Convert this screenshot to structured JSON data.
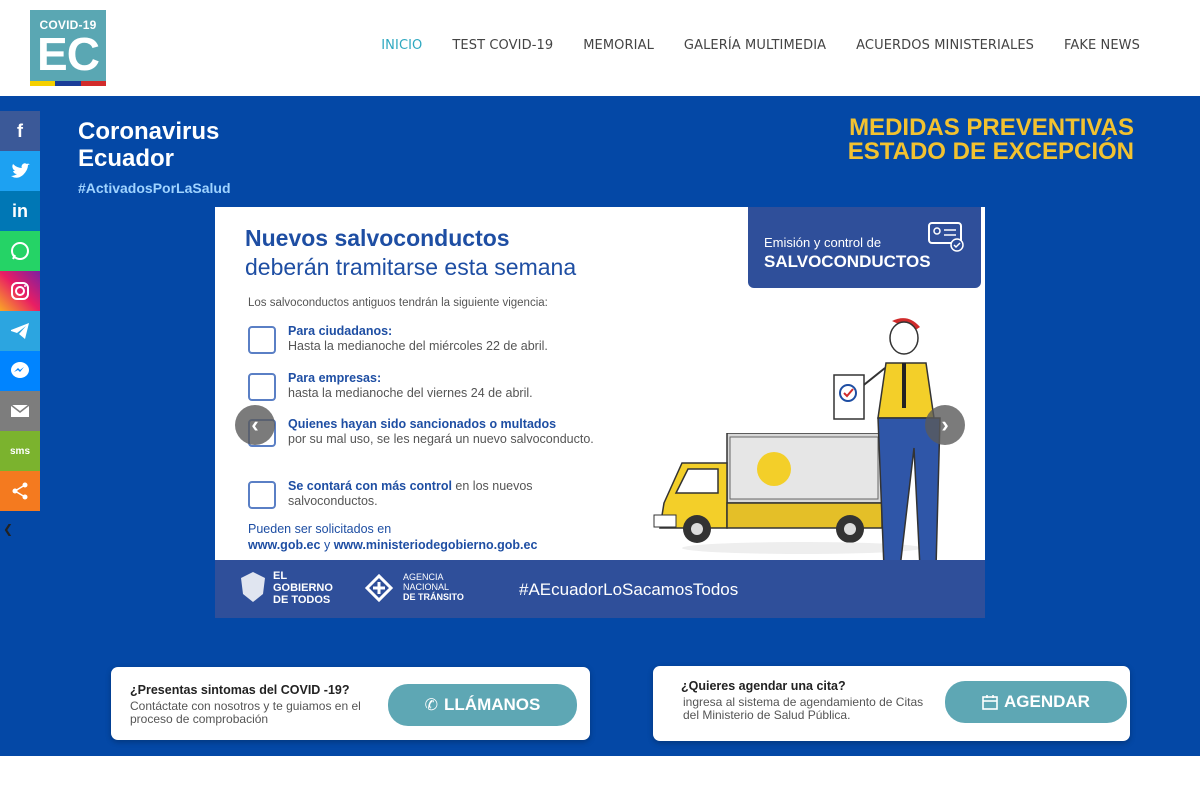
{
  "header": {
    "logo_top": "COVID-19",
    "logo_main": "EC",
    "nav": [
      "INICIO",
      "TEST COVID-19",
      "MEMORIAL",
      "GALERÍA MULTIMEDIA",
      "ACUERDOS MINISTERIALES",
      "FAKE NEWS"
    ]
  },
  "hero": {
    "brand_line1": "Coronavirus",
    "brand_line2": "Ecuador",
    "brand_tag": "#ActivadosPorLaSalud",
    "measures_title": "MEDIDAS PREVENTIVAS ESTADO DE EXCEPCIÓN"
  },
  "social": [
    "Facebook",
    "Twitter",
    "LinkedIn",
    "WhatsApp",
    "Instagram",
    "Telegram",
    "Messenger",
    "Email",
    "SMS",
    "Share"
  ],
  "slide": {
    "title_bold": "Nuevos salvoconductos",
    "title_rest": "deberán tramitarse esta semana",
    "badge_line1": "Emisión y control de",
    "badge_line2": "SALVOCONDUCTOS",
    "intro": "Los salvoconductos antiguos tendrán la siguiente vigencia:",
    "item1_head": "Para ciudadanos:",
    "item1_text": "Hasta la medianoche del miércoles 22 de abril.",
    "item2_head": "Para empresas:",
    "item2_text": "hasta la medianoche del viernes 24 de abril.",
    "item3_head": "Quienes hayan sido sancionados o multados",
    "item3_text": "por su mal uso, se les negará un nuevo salvoconducto.",
    "item4_head": "Se contará con más control",
    "item4_text": "en los nuevos salvoconductos.",
    "req_line": "Pueden ser solicitados en",
    "req_site1": "www.gob.ec",
    "req_and": "y",
    "req_site2": "www.ministeriodegobierno.gob.ec",
    "footer_gob1": "EL",
    "footer_gob2": "GOBIERNO",
    "footer_gob3": "DE TODOS",
    "footer_ant1": "AGENCIA",
    "footer_ant2": "NACIONAL",
    "footer_ant3": "DE TRÁNSITO",
    "footer_hash": "#AEcuadorLoSacamosTodos"
  },
  "cta_call": {
    "question": "¿Presentas sintomas del COVID -19?",
    "desc": "Contáctate con nosotros y te guiamos en el proceso de comprobación",
    "button": "LLÁMANOS"
  },
  "cta_appointment": {
    "question": "¿Quieres agendar una cita?",
    "desc": "ingresa al sistema de agendamiento de Citas del Ministerio de Salud Pública.",
    "button": "AGENDAR"
  },
  "colors": {
    "hero_bg": "#0448a6",
    "accent": "#5ea7b4",
    "nav_active": "#2ea8c0",
    "yellow": "#f2c230"
  }
}
